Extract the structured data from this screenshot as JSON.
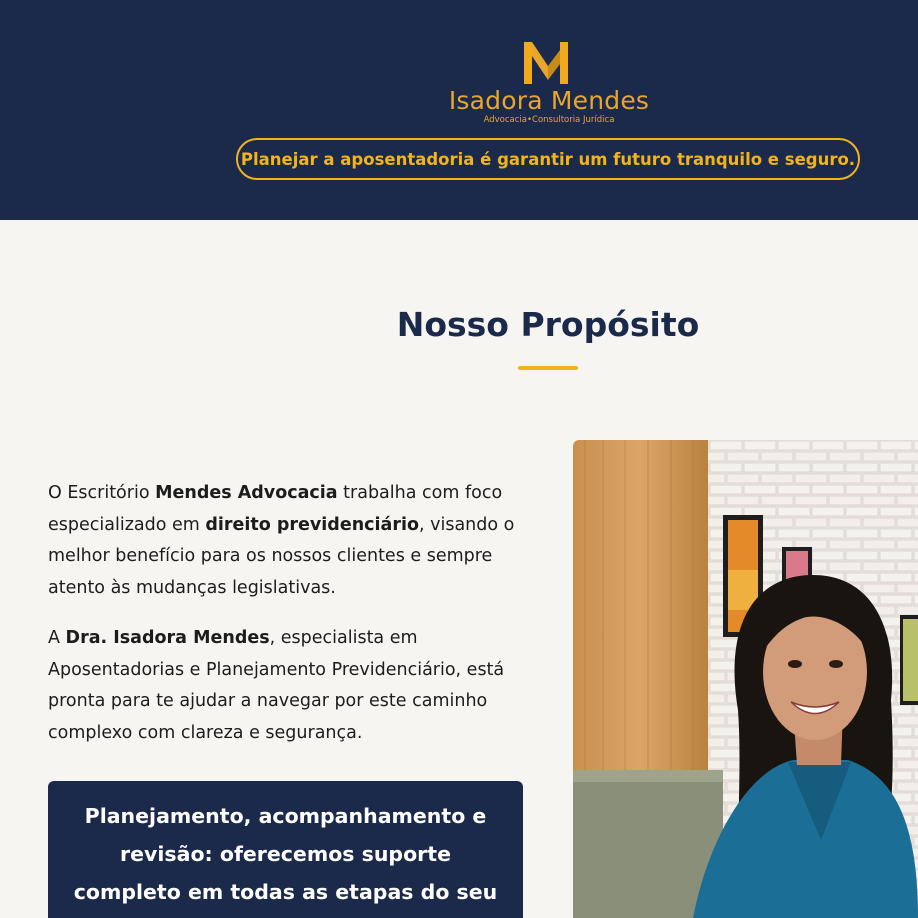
{
  "header": {
    "logo_initial": "M",
    "logo_name": "Isadora Mendes",
    "logo_subtitle": "Advocacia•Consultoria Jurídica",
    "tagline": "Planejar a aposentadoria é garantir um futuro tranquilo e seguro."
  },
  "colors": {
    "navy": "#1b2a4b",
    "gold": "#f2b41c",
    "background": "#f7f5f2"
  },
  "purpose": {
    "title": "Nosso Propósito",
    "para1": {
      "t1": "O Escritório ",
      "b1": "Mendes Advocacia",
      "t2": " trabalha com foco especializado em ",
      "b2": "direito previdenciário",
      "t3": ", visando o melhor benefício para os nossos clientes e sempre atento às mudanças legislativas."
    },
    "para2": {
      "t1": "A ",
      "b1": "Dra. Isadora Mendes",
      "t2": ", especialista em Aposentadorias e Planejamento Previdenciário, está pronta para te ajudar a navegar por este caminho complexo com clareza e segurança."
    },
    "highlight": "Planejamento, acompanhamento e revisão: oferecemos suporte completo em todas as etapas do seu benefício."
  },
  "photo": {
    "subject": "portrait-of-lawyer"
  }
}
